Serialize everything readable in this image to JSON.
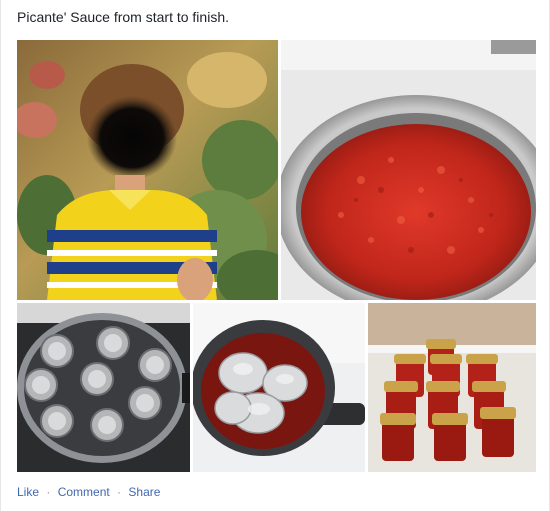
{
  "post": {
    "text": "Picante' Sauce from start to finish."
  },
  "photos": [
    {
      "subject": "child-portrait"
    },
    {
      "subject": "sauce-pot"
    },
    {
      "subject": "jars-in-canner"
    },
    {
      "subject": "lids-in-saucepan"
    },
    {
      "subject": "filled-jars"
    }
  ],
  "actions": {
    "like": "Like",
    "separator": "·",
    "comment": "Comment",
    "share": "Share"
  },
  "colors": {
    "link": "#4267b2",
    "text": "#1d2129",
    "sauce": "#c0261a"
  }
}
